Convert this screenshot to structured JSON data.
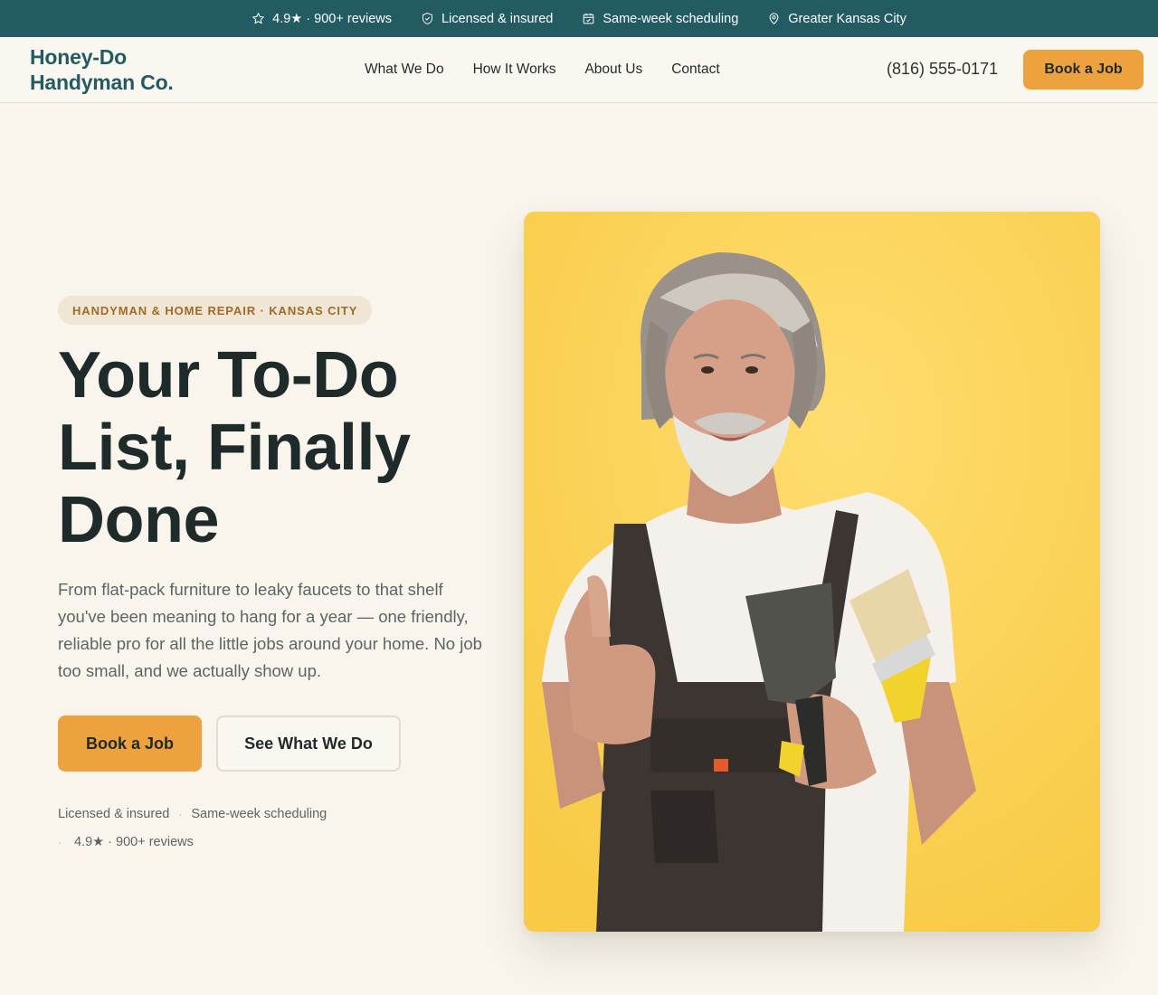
{
  "topbar": {
    "items": [
      {
        "icon": "star-icon",
        "label": "4.9★ · 900+ reviews"
      },
      {
        "icon": "shield-icon",
        "label": "Licensed & insured"
      },
      {
        "icon": "calendar-icon",
        "label": "Same-week scheduling"
      },
      {
        "icon": "map-pin-icon",
        "label": "Greater Kansas City"
      }
    ]
  },
  "header": {
    "logo_line1": "Honey-Do",
    "logo_line2": "Handyman Co.",
    "nav": [
      "What We Do",
      "How It Works",
      "About Us",
      "Contact"
    ],
    "phone": "(816) 555-0171",
    "cta": "Book a Job"
  },
  "hero": {
    "eyebrow": "HANDYMAN & HOME REPAIR · KANSAS CITY",
    "headline": [
      "Your To-Do",
      "List, Finally",
      "Done"
    ],
    "lede": "From flat-pack furniture to leaky faucets to that shelf you've been meaning to hang for a year — one friendly, reliable pro for all the little jobs around your home. No job too small, and we actually show up.",
    "primary_cta": "Book a Job",
    "secondary_cta": "See What We Do",
    "trust": {
      "line1": [
        "Licensed & insured",
        "Same-week scheduling"
      ],
      "line2": "4.9★ · 900+ reviews"
    },
    "image_subject": "smiling-handyman-with-paintbrush-and-scraper"
  },
  "colors": {
    "brand_teal": "#235b63",
    "accent_orange": "#eea23d",
    "page_bg": "#f9f5ec",
    "hero_image_bg": "#fbd55c",
    "eyebrow_text": "#a06a27"
  }
}
